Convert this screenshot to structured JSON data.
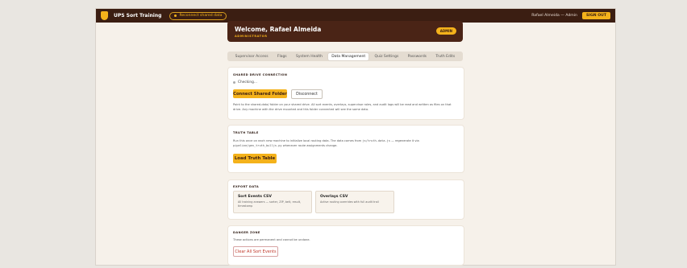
{
  "topbar": {
    "app_title": "UPS Sort Training",
    "reconnect_label": "Reconnect shared data",
    "user_label": "Rafael Almeida — Admin",
    "signout_label": "SIGN OUT"
  },
  "welcome": {
    "title": "Welcome, Rafael Almeida",
    "role": "ADMINISTRATOR",
    "badge": "ADMIN"
  },
  "tabs": [
    {
      "label": "Supervisor Access"
    },
    {
      "label": "Flags"
    },
    {
      "label": "System Health"
    },
    {
      "label": "Data Management",
      "active": true
    },
    {
      "label": "Quiz Settings"
    },
    {
      "label": "Passwords"
    },
    {
      "label": "Truth Edits"
    }
  ],
  "drive": {
    "title": "SHARED DRIVE CONNECTION",
    "status": "Checking...",
    "connect_label": "Connect Shared Folder",
    "disconnect_label": "Disconnect",
    "description": "Point to the shared-data/ folder on your shared drive. All sort events, overlays, supervisor roles, and audit logs will be read and written as files on that drive. Any machine with the drive mounted and this folder connected will see the same data."
  },
  "truth": {
    "title": "TRUTH TABLE",
    "desc_pre": "Run this once on each new machine to initialize local routing data. The data comes from ",
    "desc_code1": "js/truth-data.js",
    "desc_mid": " — regenerate it via",
    "desc_code2": "pipeline/gen_truth_bulljs.py",
    "desc_post": " whenever route assignments change.",
    "load_label": "Load Truth Table"
  },
  "export": {
    "title": "EXPORT DATA",
    "items": [
      {
        "title": "Sort Events CSV",
        "desc": "All training answers — sorter, ZIP, belt, result, timestamp"
      },
      {
        "title": "Overlays CSV",
        "desc": "Active routing overrides with full audit trail"
      }
    ]
  },
  "danger": {
    "title": "DANGER ZONE",
    "desc": "These actions are permanent and cannot be undone.",
    "clear_label": "Clear All Sort Events"
  }
}
